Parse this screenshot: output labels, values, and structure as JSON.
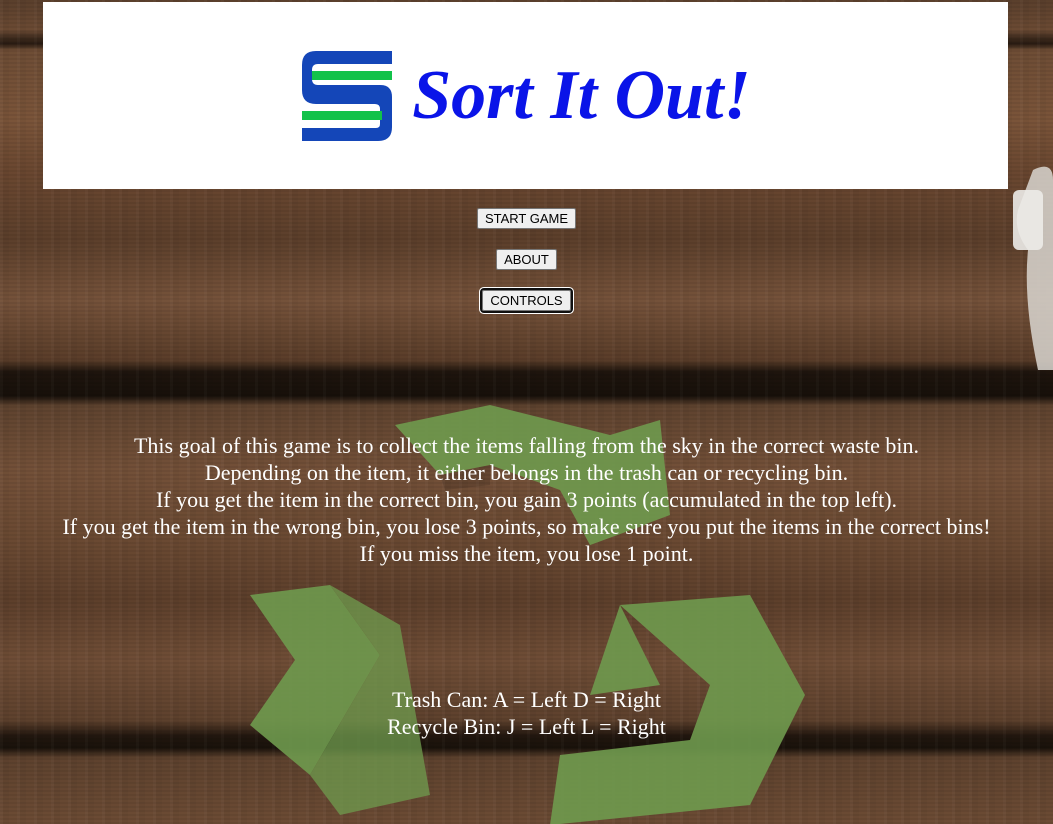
{
  "logo": {
    "title": "Sort It Out!",
    "brand_blue": "#0a14e8",
    "mark_green": "#12c24a",
    "mark_blue": "#1446b8"
  },
  "menu": {
    "start_label": "START GAME",
    "about_label": "ABOUT",
    "controls_label": "CONTROLS"
  },
  "description": {
    "lines": [
      "This goal of this game is to collect the items falling from the sky in the correct waste bin.",
      "Depending on the item, it either belongs in the trash can or recycling bin.",
      "If you get the item in the correct bin, you gain 3 points (accumulated in the top left).",
      "If you get the item in the wrong bin, you lose 3 points, so make sure you put the items in the correct bins!",
      "If you miss the item, you lose 1 point."
    ]
  },
  "controls": {
    "trash": "Trash Can: A = Left D = Right",
    "recycle": "Recycle Bin: J = Left L = Right"
  },
  "background": {
    "icon": "recycle-symbol-icon"
  }
}
